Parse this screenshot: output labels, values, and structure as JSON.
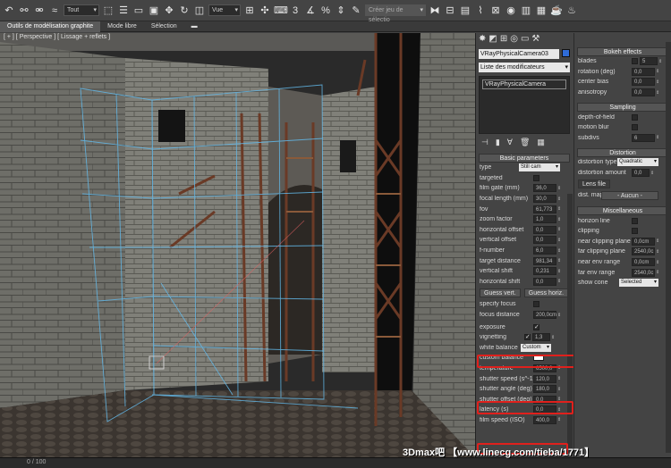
{
  "toolbar": {
    "filter": "Tout",
    "view": "Vue",
    "spinner_value": "3",
    "selset_placeholder": "Créer jeu de sélectio"
  },
  "ribbon": {
    "tabs": [
      "Outils de modélisation graphite",
      "Mode libre",
      "Sélection"
    ]
  },
  "viewport": {
    "label": "[ + ] [ Perspective ] [ Lissage + reflets ]"
  },
  "command_panel": {
    "object_name": "VRayPhysicalCamera03",
    "modifier_list": "Liste des modificateurs",
    "stack_item": "VRayPhysicalCamera",
    "section_title": "Basic parameters",
    "type_label": "type",
    "type_value": "Still cam",
    "rows": [
      {
        "label": "targeted",
        "kind": "check",
        "value": ""
      },
      {
        "label": "film gate (mm)",
        "kind": "num",
        "value": "36,0"
      },
      {
        "label": "focal length (mm)",
        "kind": "num",
        "value": "30,0"
      },
      {
        "label": "fov",
        "kind": "num",
        "value": "61,773"
      },
      {
        "label": "zoom factor",
        "kind": "num",
        "value": "1,0"
      },
      {
        "label": "horizontal offset",
        "kind": "num",
        "value": "0,0"
      },
      {
        "label": "vertical offset",
        "kind": "num",
        "value": "0,0"
      },
      {
        "label": "f-number",
        "kind": "num",
        "value": "6,0"
      },
      {
        "label": "target distance",
        "kind": "num",
        "value": "981,34"
      },
      {
        "label": "vertical shift",
        "kind": "num",
        "value": "0,231"
      },
      {
        "label": "horizontal shift",
        "kind": "num",
        "value": "0,0"
      }
    ],
    "guess_vert": "Guess vert.",
    "guess_horiz": "Guess horiz.",
    "specify_focus": "specify focus",
    "focus_distance_label": "focus distance",
    "focus_distance": "200,0cm",
    "exposure": "exposure",
    "vignetting_label": "vignetting",
    "vignetting": "1,3",
    "white_balance_label": "white balance",
    "white_balance": "Custom",
    "custom_balance": "custom balance",
    "temperature_label": "temperature",
    "temperature": "6500,0",
    "shutter_speed_label": "shutter speed (s^-1",
    "shutter_speed": "120,0",
    "shutter_angle_label": "shutter angle (deg)",
    "shutter_angle": "180,0",
    "shutter_offset_label": "shutter offset (deg)",
    "shutter_offset": "0,0",
    "latency_label": "latency (s)",
    "latency": "0,0",
    "iso_label": "film speed (ISO)",
    "iso": "400,0"
  },
  "right_panel": {
    "bokeh_title": "Bokeh effects",
    "bokeh_rows": [
      {
        "label": "blades",
        "value": "5",
        "check": true
      },
      {
        "label": "rotation (deg)",
        "value": "0,0"
      },
      {
        "label": "center bias",
        "value": "0,0"
      },
      {
        "label": "anisotropy",
        "value": "0,0"
      }
    ],
    "sampling_title": "Sampling",
    "sampling_rows": [
      {
        "label": "depth-of-field",
        "value": ""
      },
      {
        "label": "motion blur",
        "value": ""
      },
      {
        "label": "subdivs",
        "value": "6"
      }
    ],
    "distortion_title": "Distortion",
    "distortion_type_label": "distortion type",
    "distortion_type": "Quadratic",
    "distortion_amount_label": "distortion amount",
    "distortion_amount": "0,0",
    "lens_file": "Lens file",
    "dist_map": "dist. map",
    "none": "- Aucun -",
    "misc_title": "Miscellaneous",
    "misc_rows": [
      {
        "label": "horizon line",
        "value": ""
      },
      {
        "label": "clipping",
        "value": ""
      },
      {
        "label": "near clipping plane",
        "value": "0,0cm"
      },
      {
        "label": "far clipping plane",
        "value": "2540,0c"
      },
      {
        "label": "near env range",
        "value": "0,0cm"
      },
      {
        "label": "far env range",
        "value": "2540,0c"
      }
    ],
    "show_cone_label": "show cone",
    "show_cone": "Selected"
  },
  "status": {
    "frames": "0 / 100"
  },
  "watermark": "3Dmax吧 【www.linecg.com/tieba/1771】",
  "colors": {
    "highlight": "#e0201c",
    "accent": "#2f6cd8"
  }
}
